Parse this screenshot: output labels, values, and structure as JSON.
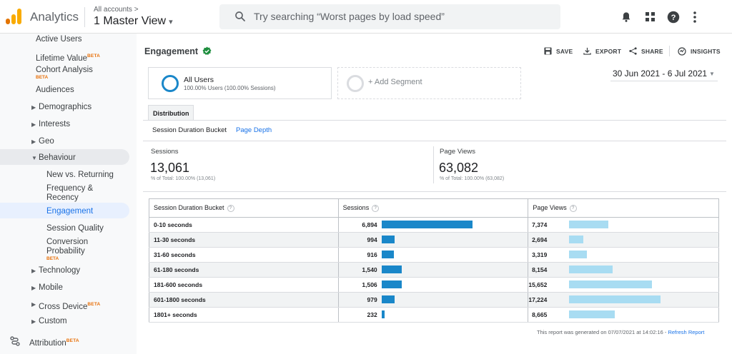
{
  "header": {
    "app_name": "Analytics",
    "account_label": "All accounts >",
    "view_name": "1 Master View",
    "view_caret": "▾",
    "search_placeholder": "Try searching “Worst pages by load speed”"
  },
  "sidebar": {
    "beta_label": "BETA",
    "items": [
      {
        "label": "Active Users"
      },
      {
        "label": "Lifetime Value"
      },
      {
        "label": "Cohort Analysis"
      },
      {
        "label": "Audiences"
      },
      {
        "label": "Demographics"
      },
      {
        "label": "Interests"
      },
      {
        "label": "Geo"
      },
      {
        "label": "Behaviour"
      },
      {
        "label": "New vs. Returning"
      },
      {
        "label": "Frequency & Recency"
      },
      {
        "label": "Engagement"
      },
      {
        "label": "Session Quality"
      },
      {
        "label": "Conversion Probability"
      },
      {
        "label": "Technology"
      },
      {
        "label": "Mobile"
      },
      {
        "label": "Cross Device"
      },
      {
        "label": "Custom"
      },
      {
        "label": "Attribution"
      }
    ]
  },
  "report": {
    "title": "Engagement",
    "actions": {
      "save": "SAVE",
      "export": "EXPORT",
      "share": "SHARE",
      "insights": "INSIGHTS"
    },
    "segment": {
      "name": "All Users",
      "sub": "100.00% Users (100.00% Sessions)",
      "add": "+ Add Segment"
    },
    "date_range": "30 Jun 2021 - 6 Jul 2021",
    "tab": "Distribution",
    "subtabs": {
      "active": "Session Duration Bucket",
      "link": "Page Depth"
    },
    "metrics": {
      "sessions": {
        "label": "Sessions",
        "value": "13,061",
        "sub": "% of Total: 100.00% (13,061)"
      },
      "pageviews": {
        "label": "Page Views",
        "value": "63,082",
        "sub": "% of Total: 100.00% (63,082)"
      }
    },
    "table": {
      "headers": {
        "bucket": "Session Duration Bucket",
        "sessions": "Sessions",
        "pageviews": "Page Views",
        "help": "?"
      },
      "rows": [
        {
          "bucket": "0-10 seconds",
          "sessions": "6,894",
          "pageviews": "7,374",
          "s": 6894,
          "p": 7374
        },
        {
          "bucket": "11-30 seconds",
          "sessions": "994",
          "pageviews": "2,694",
          "s": 994,
          "p": 2694
        },
        {
          "bucket": "31-60 seconds",
          "sessions": "916",
          "pageviews": "3,319",
          "s": 916,
          "p": 3319
        },
        {
          "bucket": "61-180 seconds",
          "sessions": "1,540",
          "pageviews": "8,154",
          "s": 1540,
          "p": 8154
        },
        {
          "bucket": "181-600 seconds",
          "sessions": "1,506",
          "pageviews": "15,652",
          "s": 1506,
          "p": 15652
        },
        {
          "bucket": "601-1800 seconds",
          "sessions": "979",
          "pageviews": "17,224",
          "s": 979,
          "p": 17224
        },
        {
          "bucket": "1801+ seconds",
          "sessions": "232",
          "pageviews": "8,665",
          "s": 232,
          "p": 8665
        }
      ]
    },
    "footer": {
      "generated": "This report was generated on 07/07/2021 at 14:02:16 - ",
      "refresh": "Refresh Report"
    }
  },
  "colors": {
    "sessions_bar": "#1a87c9",
    "pageviews_bar": "#a8dcf2",
    "accent": "#1a73e8",
    "highlight": "#e8f0fe",
    "behaviour_bg": "#e8eaed",
    "verified": "#1e8e3e",
    "logo_orange": "#f9ab00",
    "logo_dark": "#e37400"
  }
}
